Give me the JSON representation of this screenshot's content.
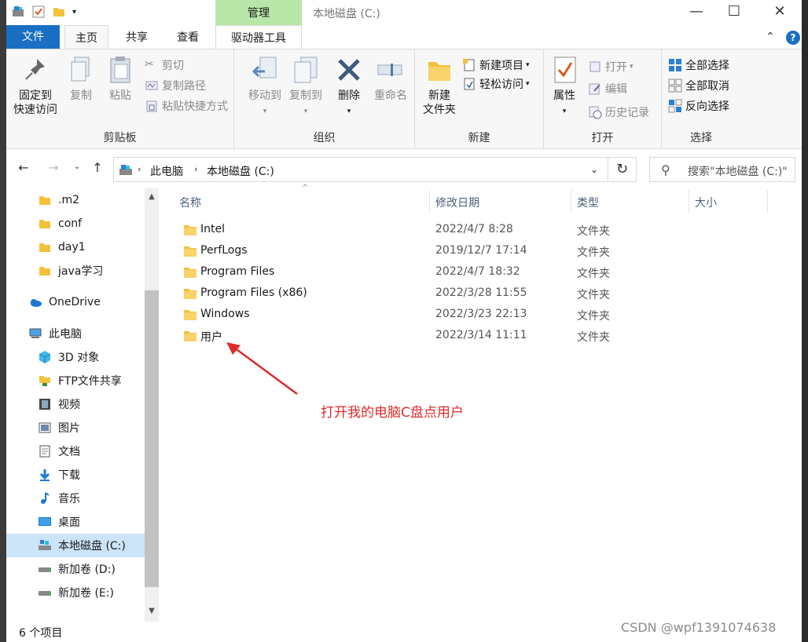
{
  "window": {
    "title": "本地磁盘 (C:)",
    "context_tab": "管理"
  },
  "ribbon_tabs": {
    "file": "文件",
    "home": "主页",
    "share": "共享",
    "view": "查看",
    "drive_tools": "驱动器工具"
  },
  "ribbon": {
    "clipboard": {
      "label": "剪贴板",
      "pin": "固定到",
      "pin2": "快速访问",
      "copy": "复制",
      "paste": "粘贴",
      "cut": "剪切",
      "copy_path": "复制路径",
      "paste_shortcut": "粘贴快捷方式"
    },
    "organize": {
      "label": "组织",
      "move_to": "移动到",
      "copy_to": "复制到",
      "delete": "删除",
      "rename": "重命名"
    },
    "new": {
      "label": "新建",
      "new_folder": "新建",
      "new_folder2": "文件夹",
      "new_item": "新建项目",
      "easy_access": "轻松访问"
    },
    "open": {
      "label": "打开",
      "properties": "属性",
      "open": "打开",
      "edit": "编辑",
      "history": "历史记录"
    },
    "select": {
      "label": "选择",
      "select_all": "全部选择",
      "select_none": "全部取消",
      "invert": "反向选择"
    }
  },
  "address": {
    "crumb1": "此电脑",
    "crumb2": "本地磁盘 (C:)",
    "search_placeholder": "搜索\"本地磁盘 (C:)\""
  },
  "nav": {
    "items": [
      {
        "label": ".m2",
        "icon": "folder-icon"
      },
      {
        "label": "conf",
        "icon": "folder-icon"
      },
      {
        "label": "day1",
        "icon": "folder-icon"
      },
      {
        "label": "java学习",
        "icon": "folder-icon"
      },
      {
        "label": "OneDrive",
        "icon": "cloud-icon"
      },
      {
        "label": "此电脑",
        "icon": "computer-icon"
      },
      {
        "label": "3D 对象",
        "icon": "cube-icon"
      },
      {
        "label": "FTP文件共享",
        "icon": "network-folder-icon"
      },
      {
        "label": "视频",
        "icon": "video-icon"
      },
      {
        "label": "图片",
        "icon": "picture-icon"
      },
      {
        "label": "文档",
        "icon": "document-icon"
      },
      {
        "label": "下载",
        "icon": "download-icon"
      },
      {
        "label": "音乐",
        "icon": "music-icon"
      },
      {
        "label": "桌面",
        "icon": "desktop-icon"
      },
      {
        "label": "本地磁盘 (C:)",
        "icon": "drive-icon"
      },
      {
        "label": "新加卷 (D:)",
        "icon": "drive-icon"
      },
      {
        "label": "新加卷 (E:)",
        "icon": "drive-icon"
      }
    ]
  },
  "columns": {
    "name": "名称",
    "date": "修改日期",
    "type": "类型",
    "size": "大小"
  },
  "files": [
    {
      "name": "Intel",
      "date": "2022/4/7 8:28",
      "type": "文件夹"
    },
    {
      "name": "PerfLogs",
      "date": "2019/12/7 17:14",
      "type": "文件夹"
    },
    {
      "name": "Program Files",
      "date": "2022/4/7 18:32",
      "type": "文件夹"
    },
    {
      "name": "Program Files (x86)",
      "date": "2022/3/28 11:55",
      "type": "文件夹"
    },
    {
      "name": "Windows",
      "date": "2022/3/23 22:13",
      "type": "文件夹"
    },
    {
      "name": "用户",
      "date": "2022/3/14 11:11",
      "type": "文件夹"
    }
  ],
  "annotation": "打开我的电脑C盘点用户",
  "status": {
    "count": "6 个项目"
  },
  "watermark": "CSDN @wpf1391074638",
  "colors": {
    "accent": "#1a6fc4",
    "manage_tab": "#b8e6a8",
    "selection": "#cce4f7",
    "folder": "#f3c13a",
    "annotation": "#e02a2a"
  }
}
